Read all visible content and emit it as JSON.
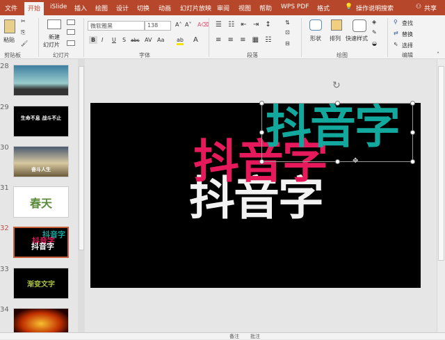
{
  "tabs": [
    "文件",
    "开始",
    "iSlide",
    "插入",
    "绘图",
    "设计",
    "切换",
    "动画",
    "幻灯片放映",
    "审阅",
    "视图",
    "帮助",
    "WPS PDF",
    "格式"
  ],
  "active_tab": "开始",
  "tell_me": "操作说明搜索",
  "share": "共享",
  "ribbon": {
    "clipboard": {
      "label": "剪贴板",
      "paste": "粘贴"
    },
    "slides": {
      "label": "幻灯片",
      "new_slide": "新建",
      "new_slide2": "幻灯片"
    },
    "font": {
      "label": "字体",
      "font_name": "微软雅黑",
      "font_size": "138",
      "bold": "B",
      "italic": "I",
      "underline": "U",
      "strike": "S",
      "abc": "abc",
      "av": "AV",
      "aa": "Aa",
      "color_a": "A"
    },
    "paragraph": {
      "label": "段落"
    },
    "drawing": {
      "label": "绘图",
      "shapes": "形状",
      "arrange": "排列",
      "quick_styles": "快速样式"
    },
    "editing": {
      "label": "编辑",
      "find": "查找",
      "replace": "替换",
      "select": "选择"
    }
  },
  "thumbnails": [
    {
      "num": "28",
      "text": ""
    },
    {
      "num": "29",
      "text": "生命不息 战斗不止"
    },
    {
      "num": "30",
      "text": "奋斗人生"
    },
    {
      "num": "31",
      "text": "春天"
    },
    {
      "num": "32",
      "text": "抖音字"
    },
    {
      "num": "33",
      "text": "渐变文字"
    },
    {
      "num": "34",
      "text": ""
    }
  ],
  "slide": {
    "teal_text": "抖音字",
    "pink_text": "抖音字",
    "white_text": "抖音字"
  },
  "colors": {
    "accent": "#b7472a",
    "teal": "#13a89e",
    "pink": "#e5195c"
  },
  "status": {
    "notes": "备注",
    "comments": "批注"
  }
}
